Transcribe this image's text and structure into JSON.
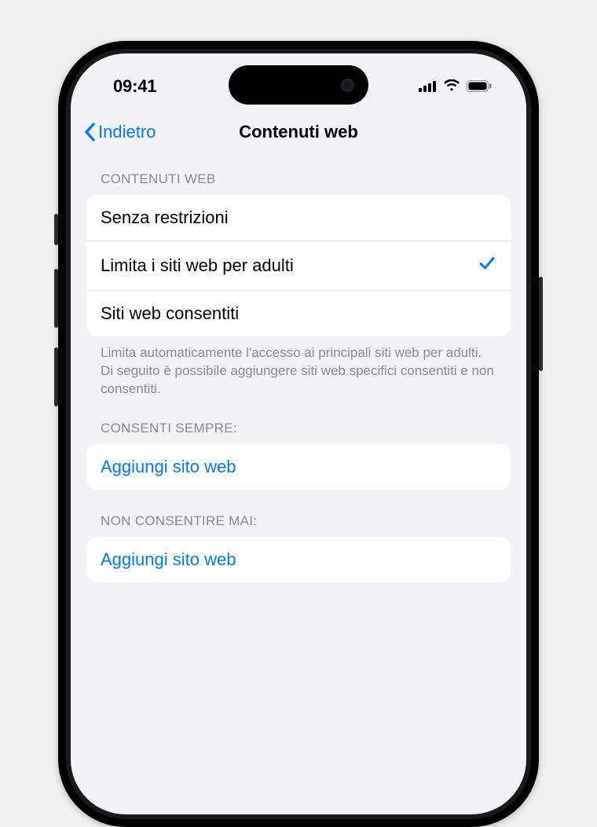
{
  "colors": {
    "accent": "#007aff",
    "background": "#f2f2f7",
    "text": "#000",
    "secondary": "#8a8a8e"
  },
  "status": {
    "time": "09:41"
  },
  "nav": {
    "back": "Indietro",
    "title": "Contenuti web"
  },
  "section1": {
    "header": "CONTENUTI WEB",
    "options": {
      "unrestricted": "Senza restrizioni",
      "limit_adult": "Limita i siti web per adulti",
      "allowed_only": "Siti web consentiti"
    },
    "selected_index": 1,
    "footer": "Limita automaticamente l'accesso ai principali siti web per adulti. Di seguito è possibile aggiungere siti web specifici consentiti e non consentiti."
  },
  "section_allow": {
    "header": "CONSENTI SEMPRE:",
    "add_label": "Aggiungi sito web"
  },
  "section_never": {
    "header": "NON CONSENTIRE MAI:",
    "add_label": "Aggiungi sito web"
  }
}
